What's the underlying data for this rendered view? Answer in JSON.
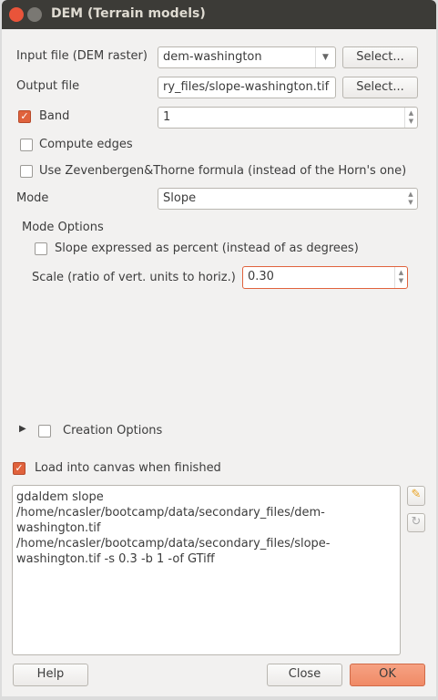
{
  "window": {
    "title": "DEM (Terrain models)"
  },
  "input": {
    "label": "Input file (DEM raster)",
    "value": "dem-washington",
    "select": "Select..."
  },
  "output": {
    "label": "Output file",
    "value": "ry_files/slope-washington.tif",
    "select": "Select..."
  },
  "band": {
    "label": "Band",
    "checked": true,
    "value": "1"
  },
  "compute_edges": {
    "label": "Compute edges",
    "checked": false
  },
  "zevenbergen": {
    "label": "Use Zevenbergen&Thorne formula (instead of the Horn's one)",
    "checked": false
  },
  "mode": {
    "label": "Mode",
    "value": "Slope"
  },
  "mode_options": {
    "heading": "Mode Options",
    "percent_label": "Slope expressed as percent (instead of as degrees)",
    "percent_checked": false,
    "scale_label": "Scale (ratio of vert. units to horiz.)",
    "scale_value": "0.30"
  },
  "creation": {
    "label": "Creation Options",
    "checked": false
  },
  "load": {
    "label": "Load into canvas when finished",
    "checked": true
  },
  "command": {
    "text": "gdaldem slope\n/home/ncasler/bootcamp/data/secondary_files/dem-\nwashington.tif\n/home/ncasler/bootcamp/data/secondary_files/slope-\nwashington.tif -s 0.3 -b 1 -of GTiff"
  },
  "buttons": {
    "help": "Help",
    "close": "Close",
    "ok": "OK"
  },
  "colors": {
    "accent": "#e0623c",
    "ok": "#f3906f",
    "titlebar": "#3c3b37"
  }
}
